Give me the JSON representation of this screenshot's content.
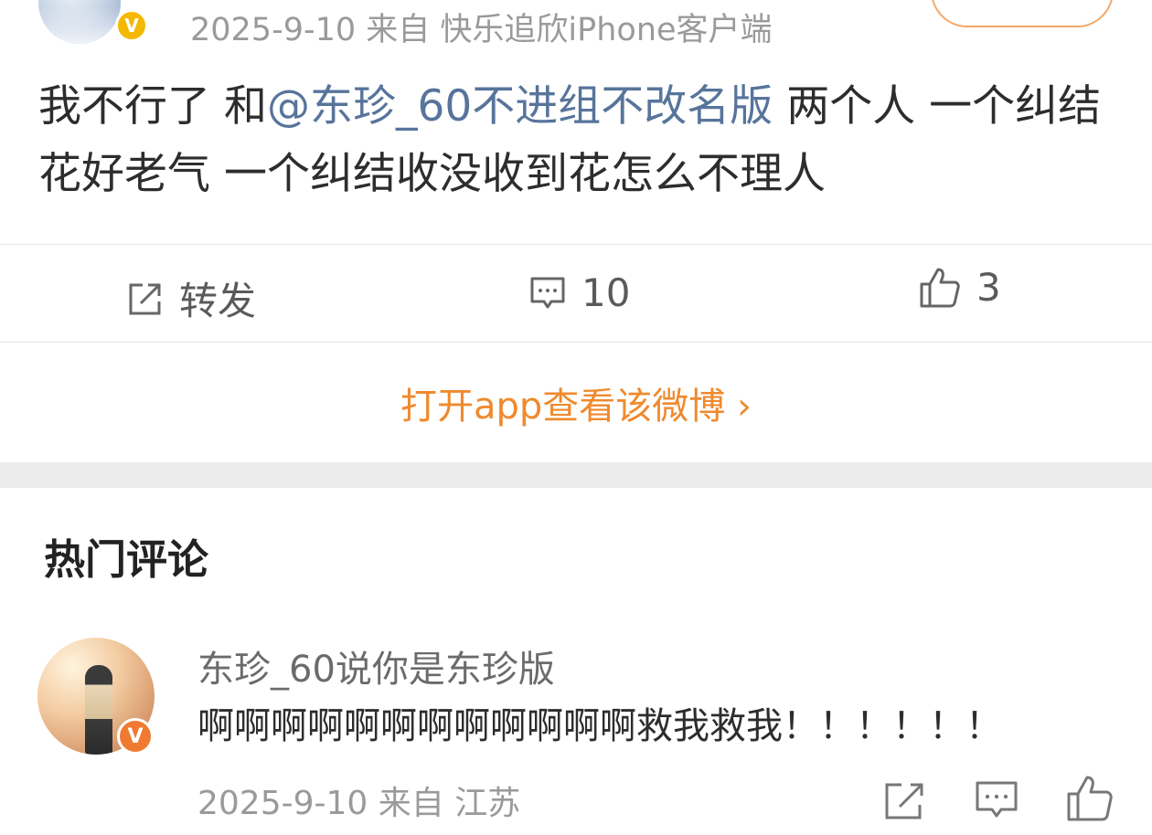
{
  "post": {
    "meta": "2025-9-10 来自 快乐追欣iPhone客户端",
    "badge": "V",
    "text_before": "我不行了 和",
    "mention": "@东珍_60不进组不改名版",
    "text_after": " 两个人 一个纠结花好老气 一个纠结收没收到花怎么不理人"
  },
  "actions": {
    "repost_label": "转发",
    "comment_count": "10",
    "like_count": "3"
  },
  "open_app_label": "打开app查看该微博 ›",
  "hot_comments": {
    "title": "热门评论",
    "items": [
      {
        "user": "东珍_60说你是东珍版",
        "badge": "V",
        "text": "啊啊啊啊啊啊啊啊啊啊啊啊救我救我！！！！！！",
        "meta": "2025-9-10 来自 江苏"
      }
    ]
  },
  "icons": [
    "share-icon",
    "comment-icon",
    "like-icon"
  ],
  "colors": {
    "accent_orange": "#ef8a2e",
    "mention_blue": "#57749b",
    "badge_yellow": "#f5b800",
    "badge_orange": "#f07a32"
  }
}
